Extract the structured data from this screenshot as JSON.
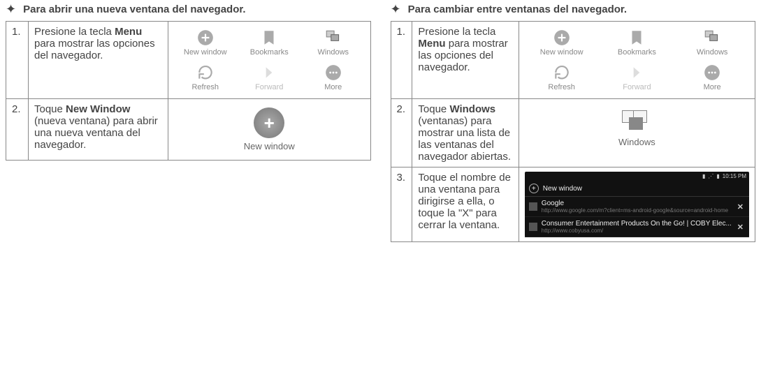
{
  "left": {
    "heading": "Para abrir una nueva ventana del navegador.",
    "steps": [
      {
        "num": "1.",
        "text_pre": "Presione la tecla ",
        "bold": "Menu",
        "text_post": " para mostrar las opciones del navegador."
      },
      {
        "num": "2.",
        "text_pre": "Toque ",
        "bold": "New Window",
        "text_post": " (nueva ventana) para abrir una nueva ventana del navegador."
      }
    ],
    "menu_labels": {
      "newwindow": "New window",
      "bookmarks": "Bookmarks",
      "windows": "Windows",
      "refresh": "Refresh",
      "forward": "Forward",
      "more": "More"
    },
    "big_label": "New window"
  },
  "right": {
    "heading": "Para cambiar entre ventanas del navegador.",
    "steps": [
      {
        "num": "1.",
        "text_pre": "Presione la tecla ",
        "bold": "Menu",
        "text_post": " para mostrar las opciones del navegador."
      },
      {
        "num": "2.",
        "text_pre": "Toque ",
        "bold": "Windows",
        "text_post": " (ventanas) para mostrar una lista de las ventanas del navegador abiertas."
      },
      {
        "num": "3.",
        "text_pre": "Toque el nombre de una ventana para dirigirse a ella, o toque la \"X\" para cerrar la ventana.",
        "bold": "",
        "text_post": ""
      }
    ],
    "menu_labels": {
      "newwindow": "New window",
      "bookmarks": "Bookmarks",
      "windows": "Windows",
      "refresh": "Refresh",
      "forward": "Forward",
      "more": "More"
    },
    "big_label": "Windows",
    "darkshot": {
      "time": "10:15 PM",
      "topbar_new": "New window",
      "rows": [
        {
          "title": "Google",
          "url": "http://www.google.com/m?client=ms-android-google&source=android-home"
        },
        {
          "title": "Consumer Entertainment Products On the Go! | COBY Elec...",
          "url": "http://www.cobyusa.com/"
        }
      ],
      "close": "✕"
    }
  }
}
